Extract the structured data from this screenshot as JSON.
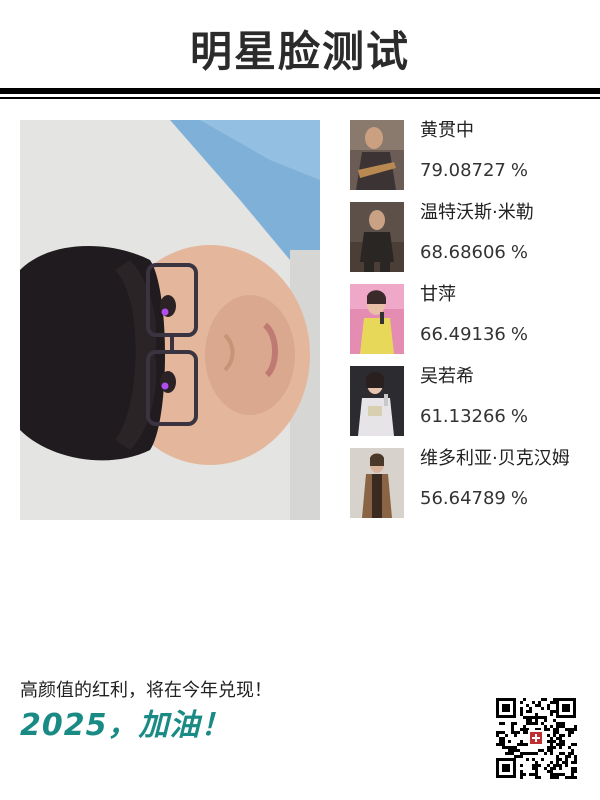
{
  "header": {
    "title": "明星脸测试"
  },
  "photo": {
    "icon": "user-photo"
  },
  "matches": [
    {
      "name": "黄贯中",
      "score": "79.08727",
      "unit": "%",
      "icon": "celebrity-photo"
    },
    {
      "name": "温特沃斯·米勒",
      "score": "68.68606",
      "unit": "%",
      "icon": "celebrity-photo"
    },
    {
      "name": "甘萍",
      "score": "66.49136",
      "unit": "%",
      "icon": "celebrity-photo"
    },
    {
      "name": "吴若希",
      "score": "61.13266",
      "unit": "%",
      "icon": "celebrity-photo"
    },
    {
      "name": "维多利亚·贝克汉姆",
      "score": "56.64789",
      "unit": "%",
      "icon": "celebrity-photo"
    }
  ],
  "footer": {
    "slogan": "高颜值的红利，将在今年兑现！",
    "motto": "2025，加油！",
    "qr_icon": "qr-code"
  },
  "colors": {
    "title": "#2b2b2b",
    "rule": "#000000",
    "motto": "#1a8a84",
    "text": "#222222"
  }
}
